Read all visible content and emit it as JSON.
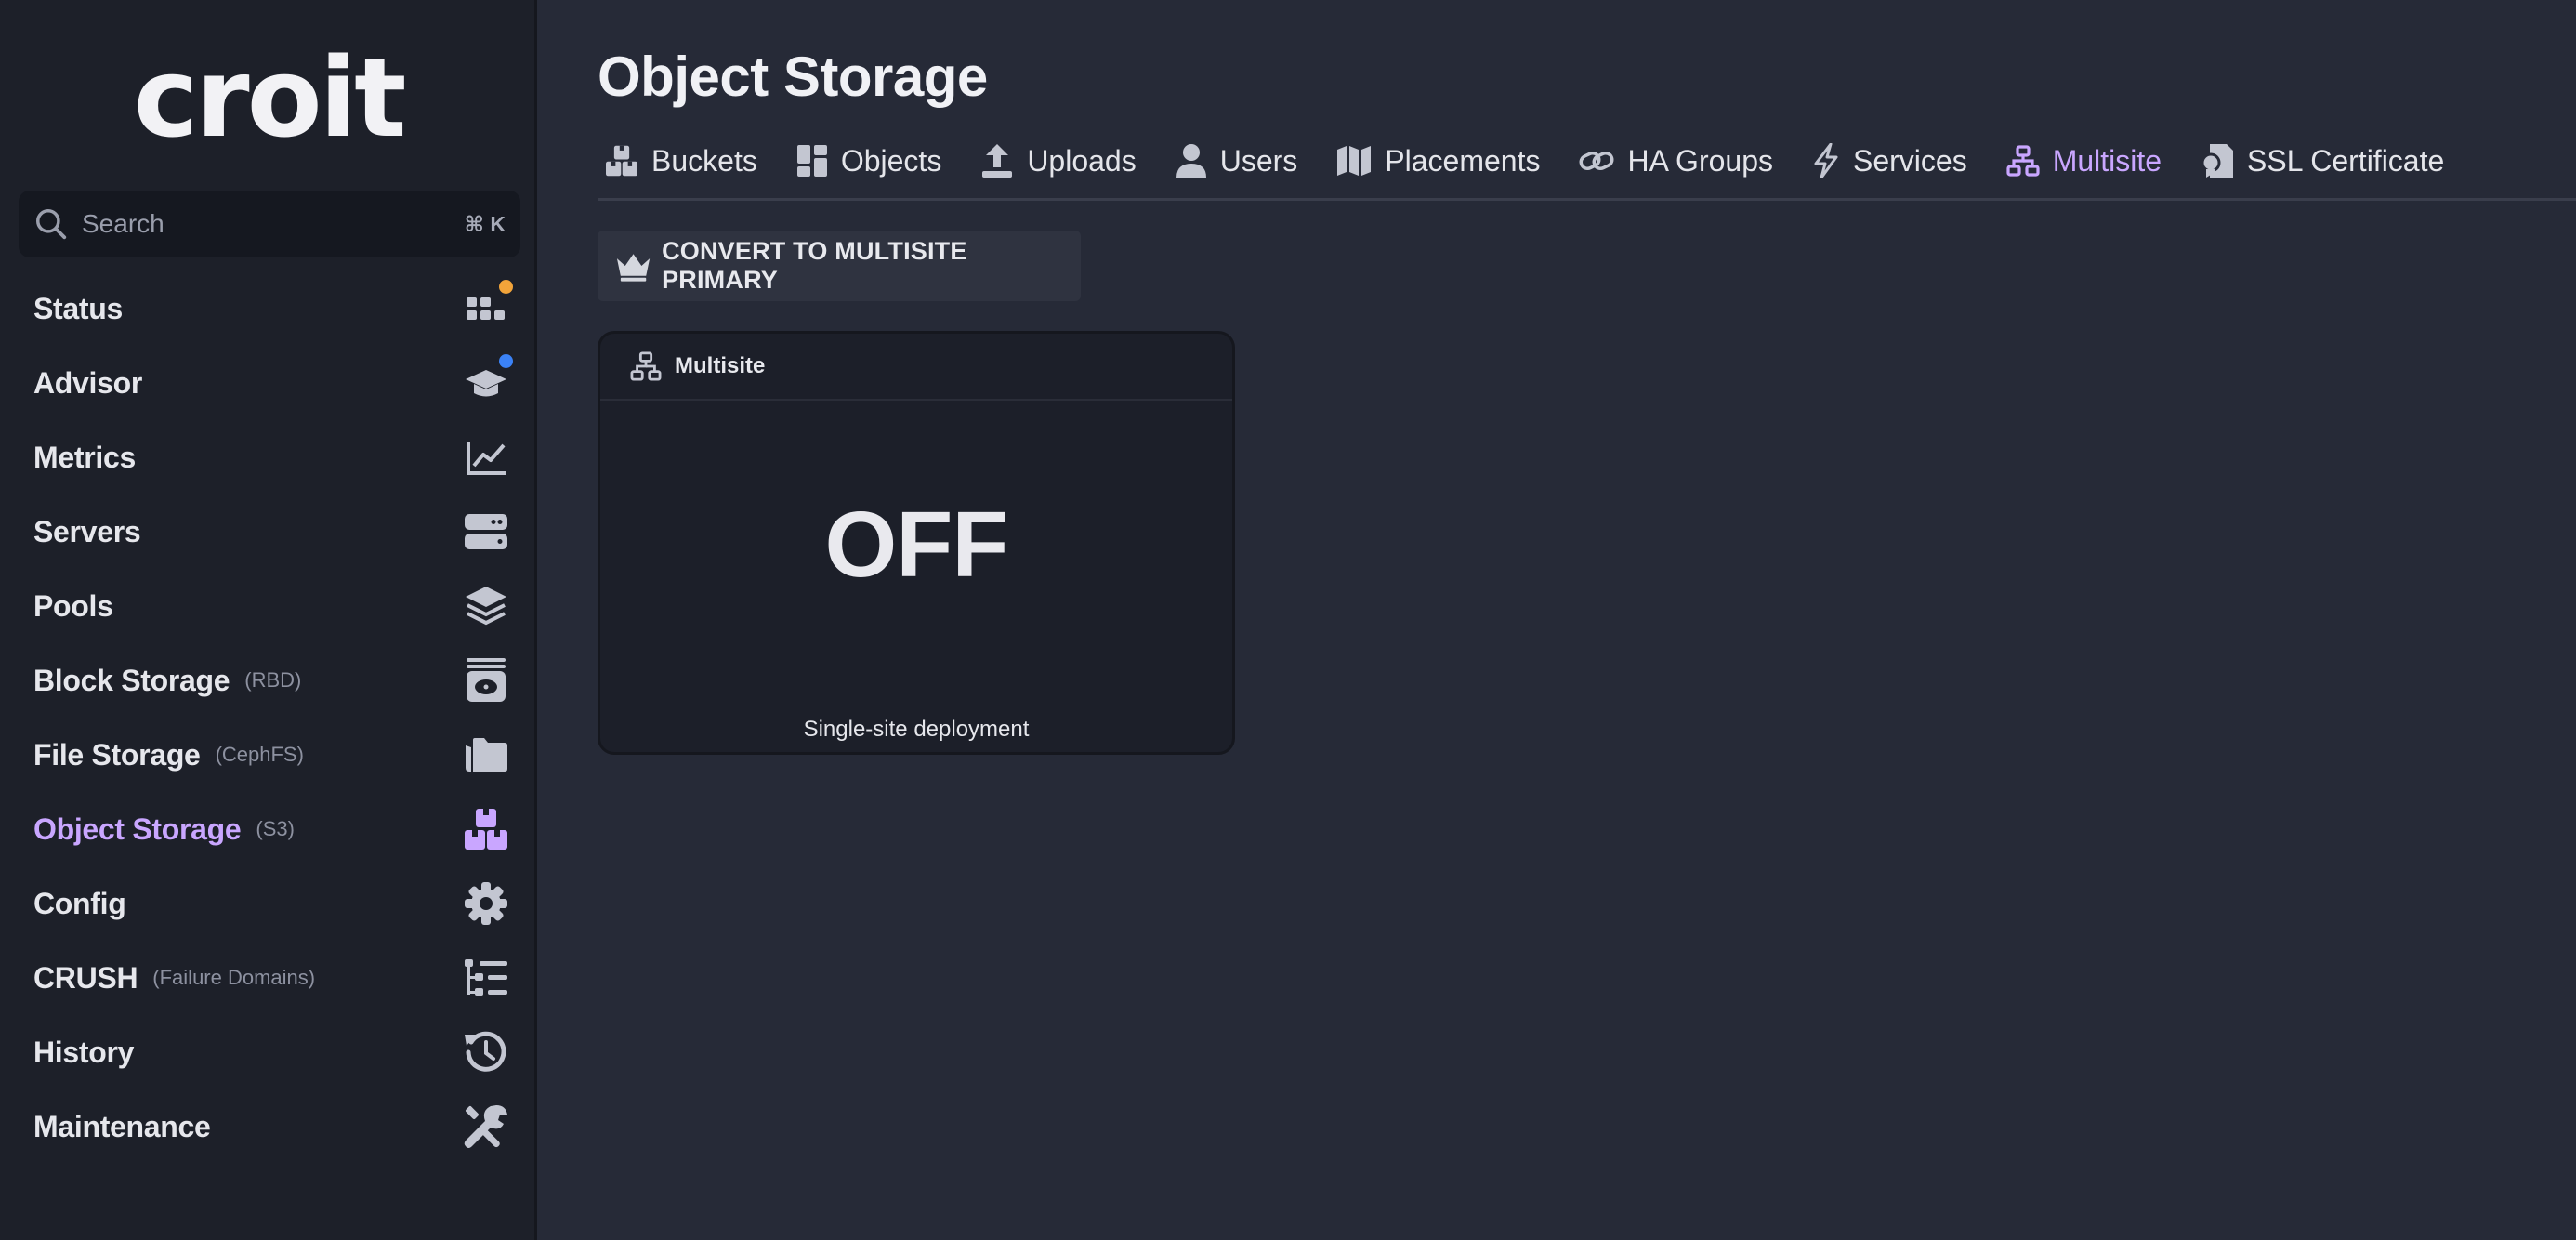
{
  "app": {
    "logo": "croit"
  },
  "search": {
    "placeholder": "Search",
    "shortcut": "⌘ K"
  },
  "colors": {
    "accent": "#c9a6ff",
    "status_dot": "#f2a43a",
    "advisor_dot": "#3b82f6"
  },
  "sidebar": {
    "items": [
      {
        "label": "Status",
        "sub": "",
        "icon": "status-grid-icon"
      },
      {
        "label": "Advisor",
        "sub": "",
        "icon": "graduation-cap-icon"
      },
      {
        "label": "Metrics",
        "sub": "",
        "icon": "line-chart-icon"
      },
      {
        "label": "Servers",
        "sub": "",
        "icon": "server-icon"
      },
      {
        "label": "Pools",
        "sub": "",
        "icon": "layers-icon"
      },
      {
        "label": "Block Storage",
        "sub": "(RBD)",
        "icon": "disk-icon"
      },
      {
        "label": "File Storage",
        "sub": "(CephFS)",
        "icon": "folder-icon"
      },
      {
        "label": "Object Storage",
        "sub": "(S3)",
        "icon": "boxes-icon",
        "active": true
      },
      {
        "label": "Config",
        "sub": "",
        "icon": "gear-icon"
      },
      {
        "label": "CRUSH",
        "sub": "(Failure Domains)",
        "icon": "tree-list-icon"
      },
      {
        "label": "History",
        "sub": "",
        "icon": "history-icon"
      },
      {
        "label": "Maintenance",
        "sub": "",
        "icon": "tools-icon"
      }
    ]
  },
  "main": {
    "title": "Object Storage",
    "tabs": [
      {
        "label": "Buckets",
        "icon": "boxes-icon"
      },
      {
        "label": "Objects",
        "icon": "objects-icon"
      },
      {
        "label": "Uploads",
        "icon": "upload-icon"
      },
      {
        "label": "Users",
        "icon": "user-icon"
      },
      {
        "label": "Placements",
        "icon": "map-icon"
      },
      {
        "label": "HA Groups",
        "icon": "link-icon"
      },
      {
        "label": "Services",
        "icon": "bolt-icon"
      },
      {
        "label": "Multisite",
        "icon": "sitemap-icon",
        "active": true
      },
      {
        "label": "SSL Certificate",
        "icon": "certificate-icon"
      }
    ],
    "convert_button": "CONVERT TO MULTISITE PRIMARY",
    "card": {
      "title": "Multisite",
      "value": "OFF",
      "caption": "Single-site deployment"
    }
  }
}
